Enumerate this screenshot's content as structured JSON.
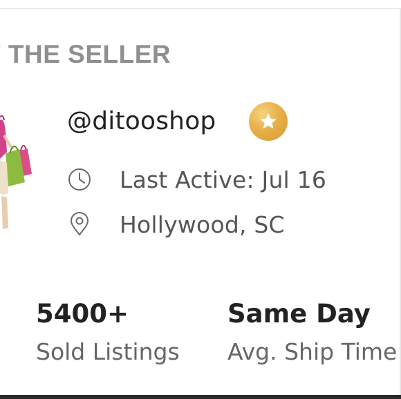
{
  "section": {
    "title": "T THE SELLER"
  },
  "seller": {
    "handle": "@ditooshop",
    "badge_icon": "star-icon",
    "last_active": "Last Active: Jul 16",
    "location": "Hollywood, SC"
  },
  "stats": [
    {
      "value": "5400+",
      "label": "Sold Listings"
    },
    {
      "value": "Same Day",
      "label": "Avg. Ship Time"
    }
  ],
  "colors": {
    "title_gray": "#8f8f8f",
    "badge_gold": "#e7b04a",
    "text_dark": "#222222",
    "text_muted": "#555555"
  }
}
